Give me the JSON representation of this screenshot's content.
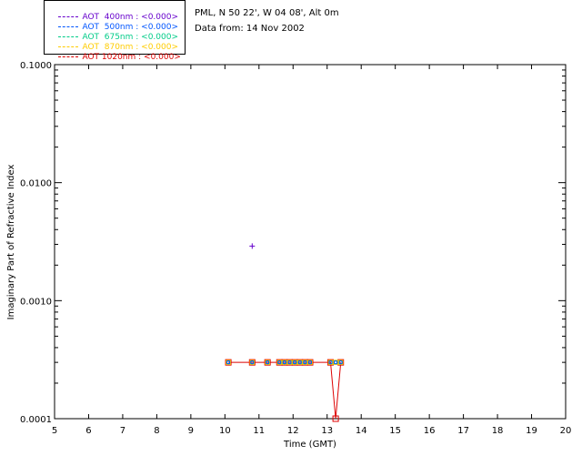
{
  "legend": [
    {
      "label": "AOT  400nm : <0.000>",
      "color": "#6600cc"
    },
    {
      "label": "AOT  500nm : <0.000>",
      "color": "#0055ff"
    },
    {
      "label": "AOT  675nm : <0.000>",
      "color": "#00cc88"
    },
    {
      "label": "AOT  870nm : <0.000>",
      "color": "#ffcc00"
    },
    {
      "label": "AOT 1020nm : <0.000>",
      "color": "#dd0000"
    }
  ],
  "info": {
    "location": "PML, N 50 22', W 04 08', Alt 0m",
    "date": "Data from: 14 Nov 2002"
  },
  "chart_data": {
    "type": "scatter",
    "xlabel": "Time (GMT)",
    "ylabel": "Imaginary Part of Refractive Index",
    "xlim": [
      5,
      20
    ],
    "ylim": [
      0.0001,
      0.1
    ],
    "y_scale": "log",
    "x_ticks": [
      "5",
      "6",
      "7",
      "8",
      "9",
      "10",
      "11",
      "12",
      "13",
      "14",
      "15",
      "16",
      "17",
      "18",
      "19",
      "20"
    ],
    "y_ticks": [
      {
        "value": 0.0001,
        "label": "0.0001"
      },
      {
        "value": 0.001,
        "label": "0.0010"
      },
      {
        "value": 0.01,
        "label": "0.0100"
      },
      {
        "value": 0.1,
        "label": "0.1000"
      }
    ],
    "grid": false,
    "series": [
      {
        "name": "AOT 400nm",
        "color": "#6600cc",
        "marker": "plus",
        "x": [
          10.8
        ],
        "y": [
          0.0029
        ]
      },
      {
        "name": "AOT 500nm",
        "color": "#0055ff",
        "marker": "circle",
        "x": [
          10.1,
          10.8,
          11.25,
          11.6,
          11.75,
          11.9,
          12.05,
          12.2,
          12.35,
          12.5,
          13.1,
          13.25,
          13.4
        ],
        "y": [
          0.0003,
          0.0003,
          0.0003,
          0.0003,
          0.0003,
          0.0003,
          0.0003,
          0.0003,
          0.0003,
          0.0003,
          0.0003,
          0.0003,
          0.0003
        ]
      },
      {
        "name": "AOT 675nm",
        "color": "#00cc88",
        "marker": "square",
        "x": [
          10.1,
          10.8,
          11.25,
          11.6,
          11.75,
          11.9,
          12.05,
          12.2,
          12.35,
          12.5,
          13.1,
          13.25,
          13.4
        ],
        "y": [
          0.0003,
          0.0003,
          0.0003,
          0.0003,
          0.0003,
          0.0003,
          0.0003,
          0.0003,
          0.0003,
          0.0003,
          0.0003,
          0.0003,
          0.0003
        ]
      },
      {
        "name": "AOT 870nm",
        "color": "#ffcc00",
        "marker": "square",
        "x": [
          10.1,
          10.8,
          11.25,
          11.6,
          11.75,
          11.9,
          12.05,
          12.2,
          12.35,
          12.5,
          13.1,
          13.25,
          13.4
        ],
        "y": [
          0.0003,
          0.0003,
          0.0003,
          0.0003,
          0.0003,
          0.0003,
          0.0003,
          0.0003,
          0.0003,
          0.0003,
          0.0003,
          0.0003,
          0.0003
        ]
      },
      {
        "name": "AOT 1020nm",
        "color": "#dd0000",
        "marker": "square",
        "line": true,
        "x": [
          10.1,
          10.8,
          11.25,
          11.6,
          11.75,
          11.9,
          12.05,
          12.2,
          12.35,
          12.5,
          13.1,
          13.25,
          13.4
        ],
        "y": [
          0.0003,
          0.0003,
          0.0003,
          0.0003,
          0.0003,
          0.0003,
          0.0003,
          0.0003,
          0.0003,
          0.0003,
          0.0003,
          0.0001,
          0.0003
        ]
      }
    ]
  }
}
